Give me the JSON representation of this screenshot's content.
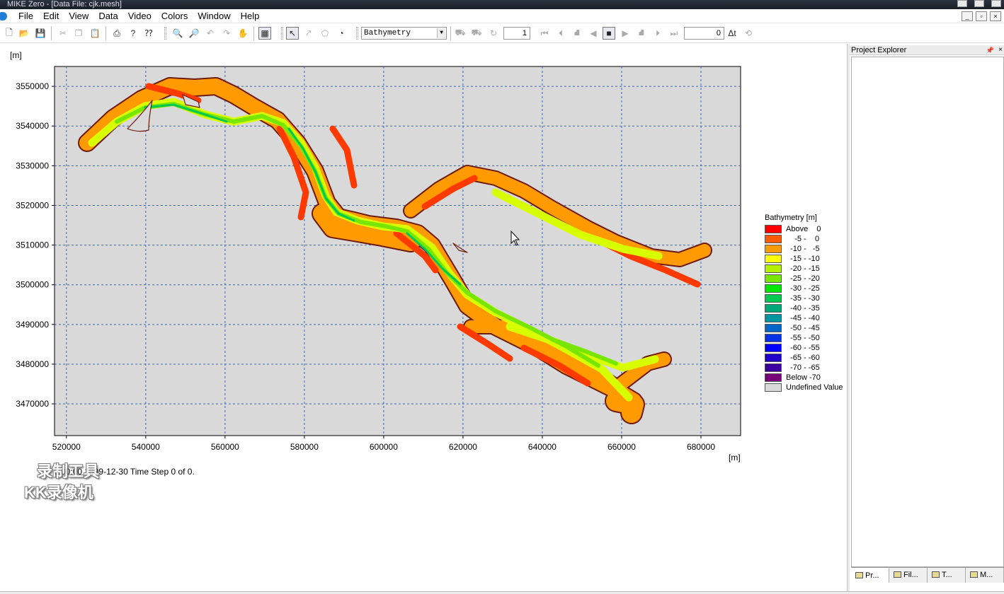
{
  "window": {
    "title": "MIKE Zero - [Data File: cjk.mesh]"
  },
  "menu": [
    "File",
    "Edit",
    "View",
    "Data",
    "Video",
    "Colors",
    "Window",
    "Help"
  ],
  "toolbar": {
    "item_selector": "Bathymetry",
    "time_step_value": "1",
    "time_value": "0",
    "delta_t_label": "Δt"
  },
  "plot": {
    "x_unit": "[m]",
    "y_unit": "[m]",
    "status_text": "0:00:00 1899-12-30  Time Step 0 of 0.",
    "watermark_line1": "录制工具",
    "watermark_line2": "KK录像机"
  },
  "chart_data": {
    "type": "heatmap",
    "xlim": [
      517000,
      690000
    ],
    "ylim": [
      3462000,
      3555000
    ],
    "x_ticks": [
      520000,
      540000,
      560000,
      580000,
      600000,
      620000,
      640000,
      660000,
      680000
    ],
    "y_ticks": [
      3470000,
      3480000,
      3490000,
      3500000,
      3510000,
      3520000,
      3530000,
      3540000,
      3550000
    ],
    "x_tick_labels": [
      "520000",
      "540000",
      "560000",
      "580000",
      "600000",
      "620000",
      "640000",
      "660000",
      "680000"
    ],
    "y_tick_labels": [
      "3470000",
      "3480000",
      "3490000",
      "3500000",
      "3510000",
      "3520000",
      "3530000",
      "3540000",
      "3550000"
    ],
    "grid": true,
    "legend_position": "right",
    "legend": {
      "title": "Bathymetry [m]",
      "entries": [
        {
          "label": "Above    0",
          "color": "#ff0000"
        },
        {
          "label": "    -5 -    0",
          "color": "#ff5a00"
        },
        {
          "label": "  -10 -   -5",
          "color": "#ff9a00"
        },
        {
          "label": "  -15 - -10",
          "color": "#ffff00"
        },
        {
          "label": "  -20 - -15",
          "color": "#b4f000"
        },
        {
          "label": "  -25 - -20",
          "color": "#78e600"
        },
        {
          "label": "  -30 - -25",
          "color": "#00e600"
        },
        {
          "label": "  -35 - -30",
          "color": "#00c850"
        },
        {
          "label": "  -40 - -35",
          "color": "#00a878"
        },
        {
          "label": "  -45 - -40",
          "color": "#0096a0"
        },
        {
          "label": "  -50 - -45",
          "color": "#0064c8"
        },
        {
          "label": "  -55 - -50",
          "color": "#0032e6"
        },
        {
          "label": "  -60 - -55",
          "color": "#0000ff"
        },
        {
          "label": "  -65 - -60",
          "color": "#1e00c8"
        },
        {
          "label": "  -70 - -65",
          "color": "#3c00a0"
        },
        {
          "label": "Below -70",
          "color": "#780078"
        },
        {
          "label": "Undefined Value",
          "color": "#d9d9d9"
        }
      ]
    }
  },
  "project_explorer": {
    "title": "Project Explorer",
    "tabs": [
      "Pr...",
      "Fil...",
      "T...",
      "M..."
    ]
  }
}
